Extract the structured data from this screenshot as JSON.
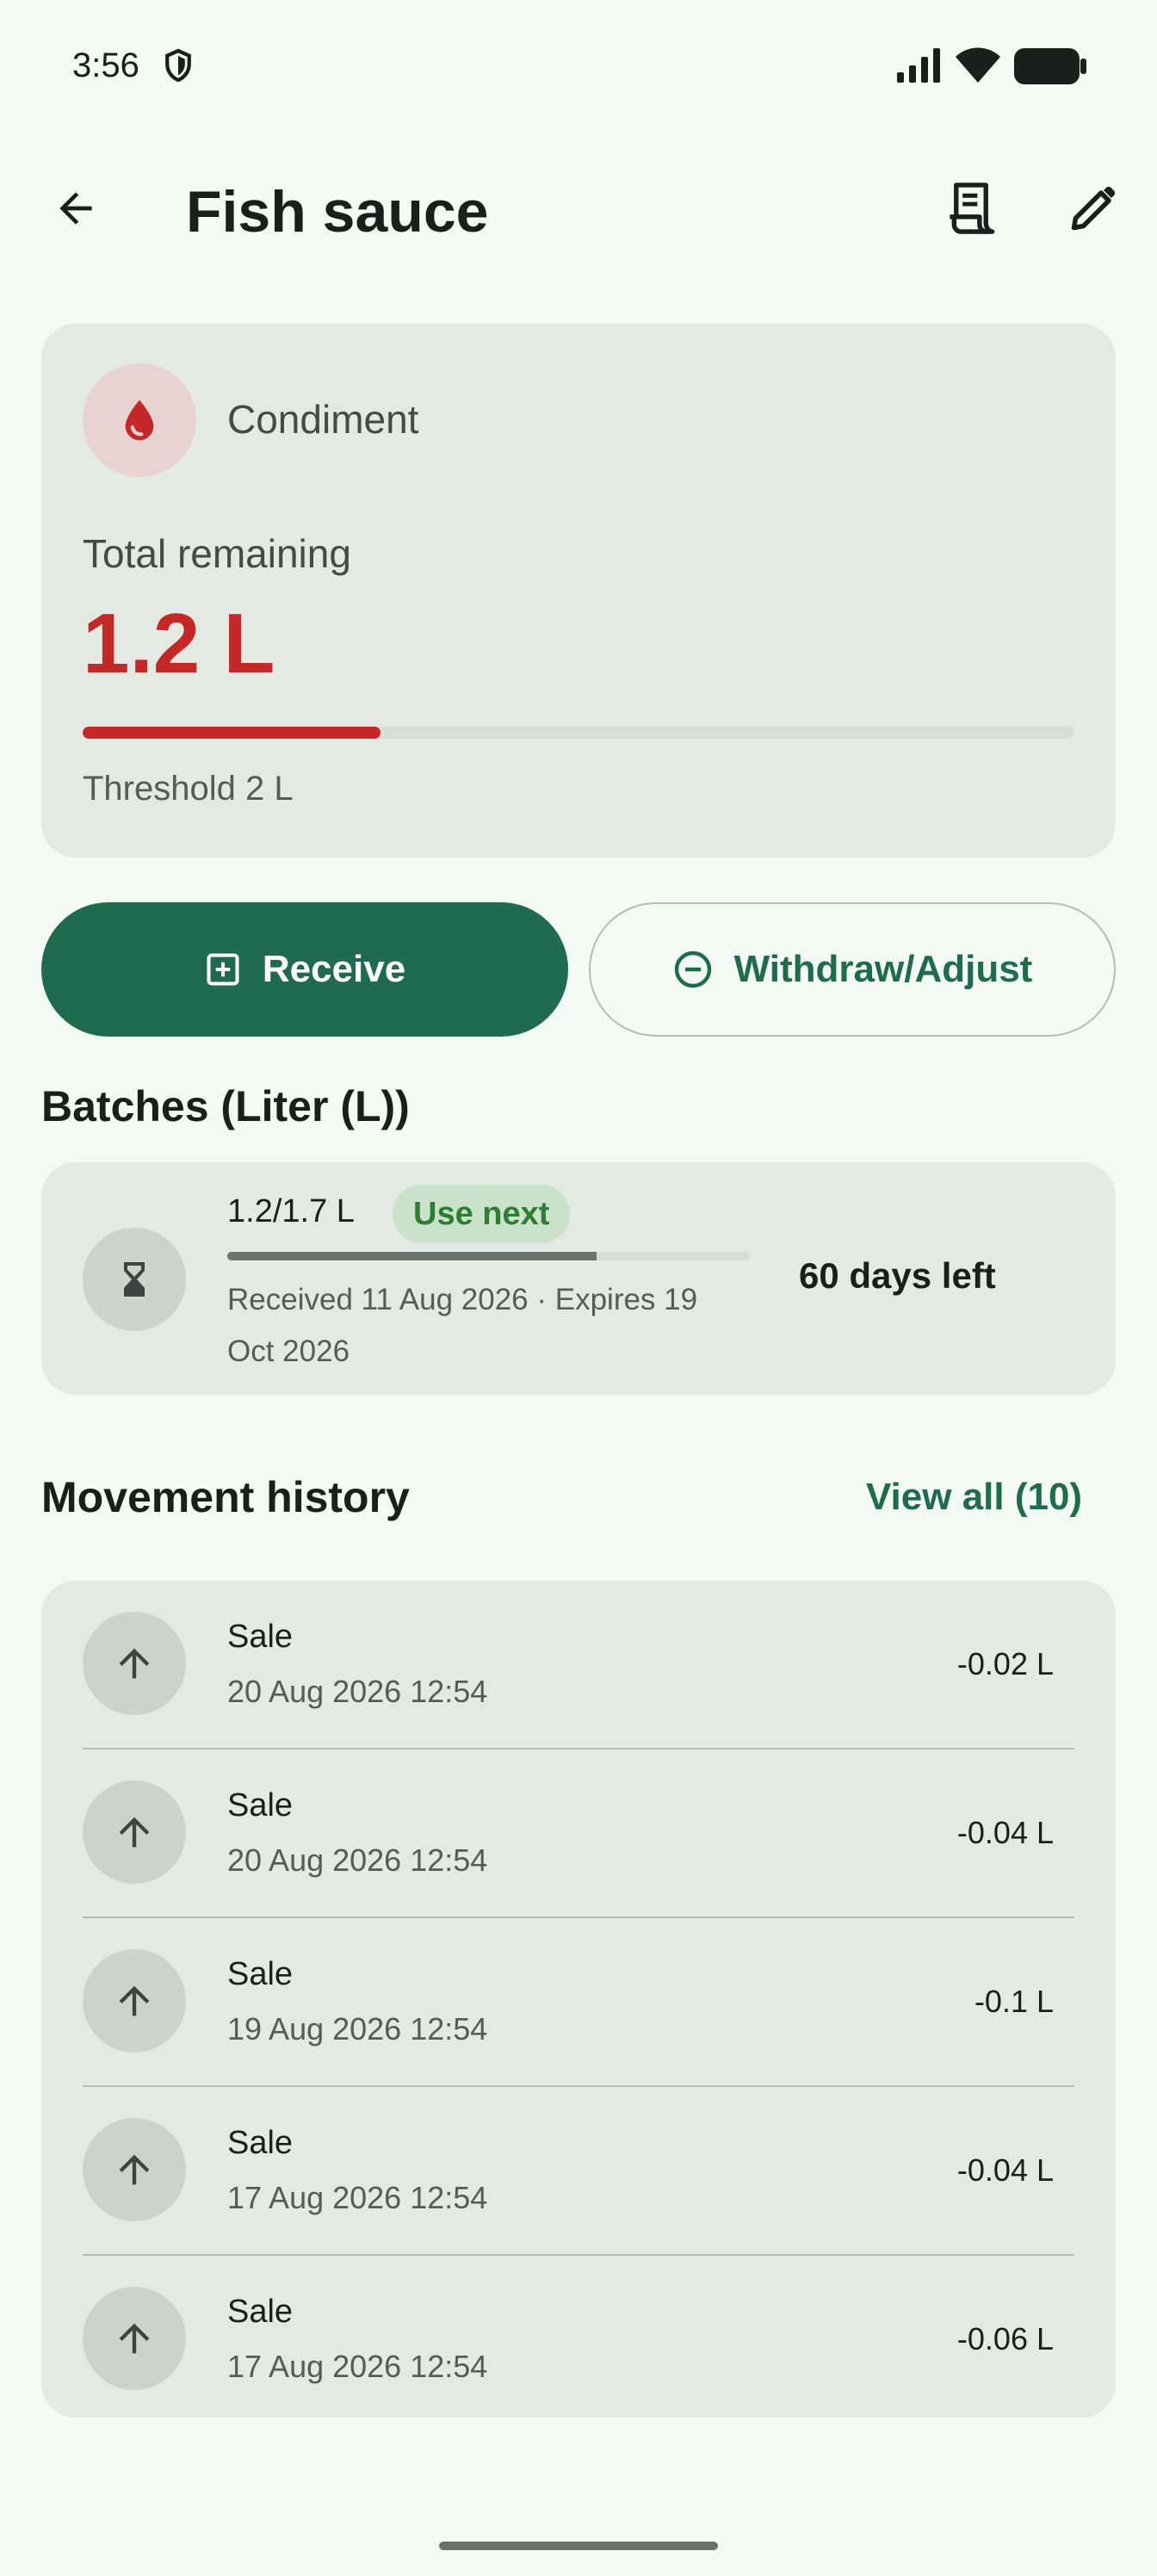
{
  "status_bar": {
    "time": "3:56"
  },
  "header": {
    "title": "Fish sauce"
  },
  "summary": {
    "category": "Condiment",
    "remaining_label": "Total remaining",
    "remaining_value": "1.2 L",
    "remaining_fraction": 0.3,
    "threshold_label": "Threshold 2 L"
  },
  "actions": {
    "receive_label": "Receive",
    "withdraw_label": "Withdraw/Adjust"
  },
  "batches": {
    "title": "Batches (Liter (L))",
    "items": [
      {
        "qty": "1.2/1.7 L",
        "badge": "Use next",
        "fill_fraction": 0.706,
        "meta": "Received 11 Aug 2026 · Expires 19 Oct 2026",
        "days_left": "60 days left"
      }
    ]
  },
  "history": {
    "title": "Movement history",
    "view_all": "View all (10)",
    "items": [
      {
        "type": "Sale",
        "date": "20 Aug 2026 12:54",
        "qty": "-0.02 L"
      },
      {
        "type": "Sale",
        "date": "20 Aug 2026 12:54",
        "qty": "-0.04 L"
      },
      {
        "type": "Sale",
        "date": "19 Aug 2026 12:54",
        "qty": "-0.1 L"
      },
      {
        "type": "Sale",
        "date": "17 Aug 2026 12:54",
        "qty": "-0.04 L"
      },
      {
        "type": "Sale",
        "date": "17 Aug 2026 12:54",
        "qty": "-0.06 L"
      }
    ]
  },
  "colors": {
    "accent": "#1e6b4f",
    "alert": "#c62828",
    "badge_bg": "#c9e2c9",
    "badge_text": "#2e7d32",
    "card_bg": "#e3eae3",
    "page_bg": "#f3f9f3"
  },
  "icons": {
    "category": "water-drop-icon",
    "batch": "hourglass-icon",
    "movement": "arrow-up-icon"
  }
}
